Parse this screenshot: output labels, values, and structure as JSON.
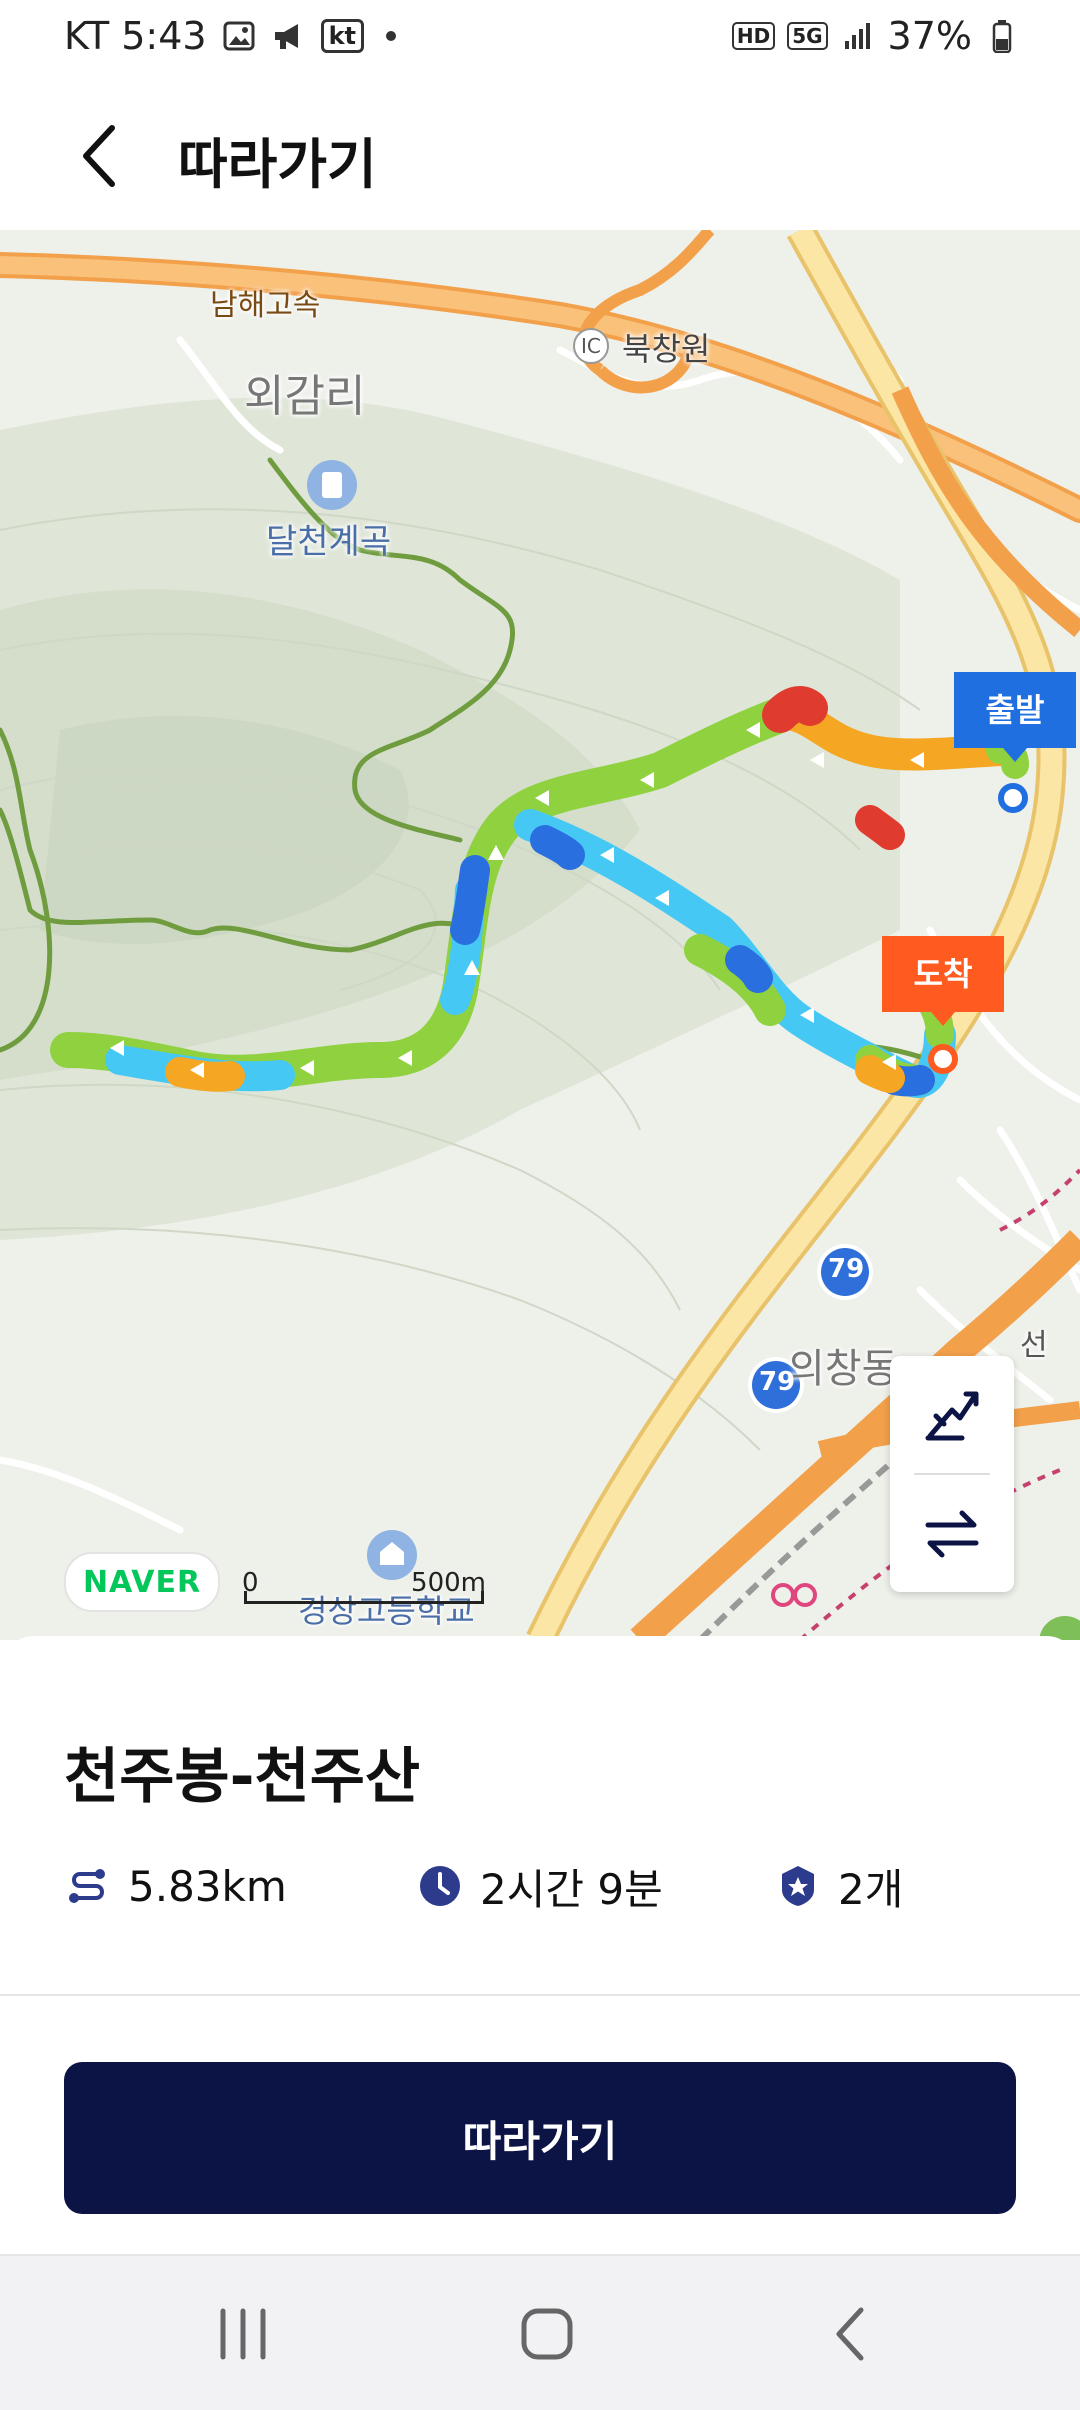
{
  "status_bar": {
    "carrier_time": "KT 5:43",
    "kt_badge": "kt",
    "hd_badge": "HD",
    "network": "5G",
    "battery": "37%"
  },
  "header": {
    "title": "따라가기",
    "back_icon": "chevron-left-icon"
  },
  "map": {
    "labels": {
      "expressway": "남해고속",
      "ic_badge": "IC",
      "ic_name": "북창원",
      "village": "외감리",
      "valley": "달천계곡",
      "district": "의창동",
      "school": "경상고등학교",
      "rail_suffix": "선",
      "route_shield_1": "79",
      "route_shield_2": "79"
    },
    "markers": {
      "start": "출발",
      "end": "도착"
    },
    "brand": "NAVER",
    "scale": {
      "start": "0",
      "end": "500m"
    },
    "controls": [
      {
        "name": "elevation-profile-icon"
      },
      {
        "name": "swap-direction-icon"
      }
    ],
    "route_colors": {
      "green": "#8fd13f",
      "cyan": "#46c8f5",
      "blue": "#2a6fe0",
      "orange": "#f5a623",
      "red": "#e03b2f",
      "trail": "#6f9c3e"
    }
  },
  "course": {
    "title": "천주봉-천주산",
    "distance": "5.83km",
    "duration": "2시간 9분",
    "peaks": "2개"
  },
  "cta": {
    "label": "따라가기"
  },
  "nav": [
    "recent-apps-icon",
    "home-icon",
    "back-icon"
  ]
}
